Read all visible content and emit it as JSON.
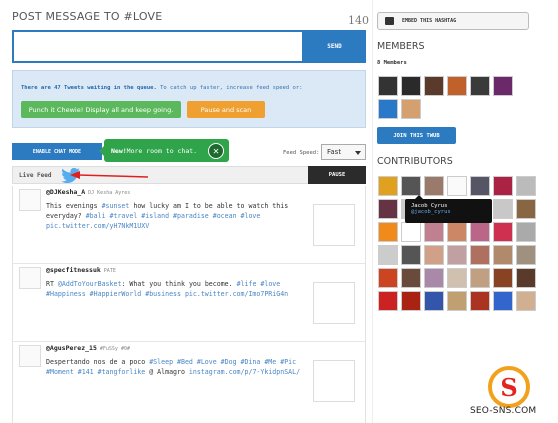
{
  "compose": {
    "title": "POST MESSAGE TO #LOVE",
    "char_count": "140",
    "message_value": "",
    "send_label": "SEND"
  },
  "queue": {
    "message_strong": "There are 47 Tweets waiting in the queue.",
    "message_rest": " To catch up faster, increase feed speed or:",
    "punch_label": "Punch it Chewie! Display all and keep going.",
    "pause_label": "Pause and scan"
  },
  "controls": {
    "chat_mode_label": "ENABLE CHAT MODE",
    "tip_strong": "New!",
    "tip_rest": " More room to chat.",
    "speed_label": "Feed Speed:",
    "speed_value": "Fast",
    "live_feed_label": "Live Feed",
    "pause_label": "PAUSE"
  },
  "tweets": [
    {
      "user": "@DJKesha_A",
      "name": "DJ Kesha Ayres",
      "text_plain": "This evenings ",
      "parts": [
        {
          "t": "This evenings ",
          "tag": false
        },
        {
          "t": "#sunset",
          "tag": true
        },
        {
          "t": " how lucky am I to be able to watch this everyday? ",
          "tag": false
        },
        {
          "t": "#bali #travel #island #paradise #ocean #love pic.twitter.com/yH7NkM1UXV",
          "tag": true
        }
      ]
    },
    {
      "user": "@specfitnessuk",
      "name": "PATE",
      "parts": [
        {
          "t": "RT ",
          "tag": false
        },
        {
          "t": "@AddToYourBasket",
          "tag": true
        },
        {
          "t": ": What you think you become. ",
          "tag": false
        },
        {
          "t": "#life #love #Happiness #HappierWorld #business pic.twitter.com/Imo7PRiG4n",
          "tag": true
        }
      ]
    },
    {
      "user": "@AgusPerez_15",
      "name": "#FuSSy #0#",
      "parts": [
        {
          "t": "Despertando nos de a poco ",
          "tag": false
        },
        {
          "t": "#Sleep #Bed #Love #Dog #Dina #Me #Pic #Moment #141 #tangforlike",
          "tag": true
        },
        {
          "t": " @ Almagro ",
          "tag": false
        },
        {
          "t": "instagram.com/p/7-YkidpnSAL/",
          "tag": true
        }
      ]
    }
  ],
  "sidebar": {
    "embed_label": "EMBED THIS HASHTAG",
    "members_title": "MEMBERS",
    "members_count": "8 Members",
    "join_label": "JOIN THIS TWUB",
    "contributors_title": "CONTRIBUTORS",
    "tooltip_name": "Jacob Cyrus",
    "tooltip_handle": "@jacob_cyrus"
  },
  "watermark": {
    "logo_letter": "S",
    "text": "SEO-SNS.COM"
  },
  "colors": {
    "accent_blue": "#2c7bc0",
    "green": "#5cb85c",
    "orange": "#f0a030",
    "hashtag_blue": "#4a86c5"
  },
  "member_colors": [
    "#333333",
    "#2a2a2a",
    "#5a3a2a",
    "#c0602a",
    "#3a3a3a",
    "#6a2a6a",
    "#2a78c8",
    "#d4a070"
  ],
  "contributor_colors": [
    "#e0a020",
    "#555555",
    "#9a7a6a",
    "#fafafa",
    "#555566",
    "#aa2244",
    "#bbbbbb",
    "#663344",
    "#cccccc",
    "#111111",
    "#3a6a3a",
    "#b02020",
    "#c8c8c8",
    "#886644",
    "#f08a1a",
    "#ffffff",
    "#c08090",
    "#cc8866",
    "#bb6688",
    "#d03050",
    "#aaaaaa",
    "#cccccc",
    "#555555",
    "#d0a088",
    "#c0a0a0",
    "#b07060",
    "#b08a6a",
    "#a09080",
    "#cc4422",
    "#6a4a3a",
    "#aa88aa",
    "#d0c0b0",
    "#c0a080",
    "#884422",
    "#5a3a2a",
    "#cc2222",
    "#aa2211",
    "#3355aa",
    "#c0a070",
    "#aa3322",
    "#3366cc",
    "#d0b090"
  ]
}
